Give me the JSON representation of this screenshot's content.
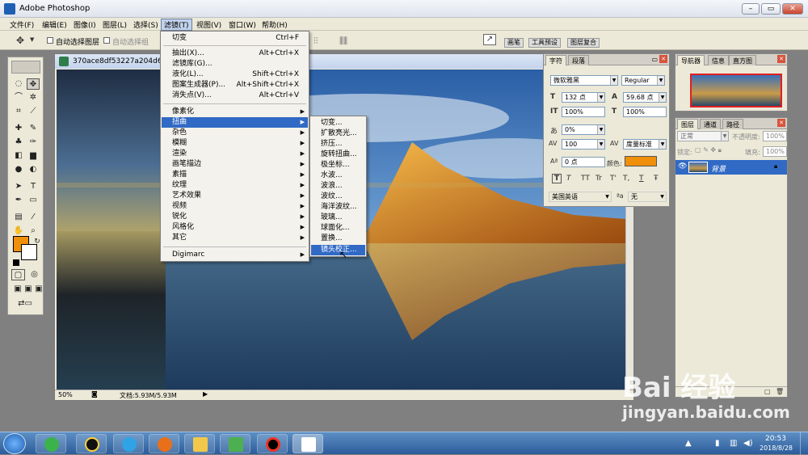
{
  "app": {
    "title": "Adobe Photoshop"
  },
  "menubar": [
    "文件(F)",
    "编辑(E)",
    "图像(I)",
    "图层(L)",
    "选择(S)",
    "滤镜(T)",
    "视图(V)",
    "窗口(W)",
    "帮助(H)"
  ],
  "options_bar": {
    "auto_select_layer": "自动选择图层",
    "auto_select_group": "自动选择组"
  },
  "palette_well": [
    "画笔",
    "工具预设",
    "图层复合"
  ],
  "document": {
    "title": "370ace8df53227a204d64c",
    "zoom": "50%",
    "doc_info": "文档:5.93M/5.93M"
  },
  "filter_menu": {
    "items": [
      {
        "label": "切变",
        "shortcut": "Ctrl+F"
      },
      {
        "label": "抽出(X)...",
        "shortcut": "Alt+Ctrl+X"
      },
      {
        "label": "滤镜库(G)...",
        "shortcut": ""
      },
      {
        "label": "液化(L)...",
        "shortcut": "Shift+Ctrl+X"
      },
      {
        "label": "图案生成器(P)...",
        "shortcut": "Alt+Shift+Ctrl+X"
      },
      {
        "label": "消失点(V)...",
        "shortcut": "Alt+Ctrl+V"
      },
      {
        "label": "像素化",
        "shortcut": ""
      },
      {
        "label": "扭曲",
        "shortcut": ""
      },
      {
        "label": "杂色",
        "shortcut": ""
      },
      {
        "label": "模糊",
        "shortcut": ""
      },
      {
        "label": "渲染",
        "shortcut": ""
      },
      {
        "label": "画笔描边",
        "shortcut": ""
      },
      {
        "label": "素描",
        "shortcut": ""
      },
      {
        "label": "纹理",
        "shortcut": ""
      },
      {
        "label": "艺术效果",
        "shortcut": ""
      },
      {
        "label": "视频",
        "shortcut": ""
      },
      {
        "label": "锐化",
        "shortcut": ""
      },
      {
        "label": "风格化",
        "shortcut": ""
      },
      {
        "label": "其它",
        "shortcut": ""
      },
      {
        "label": "Digimarc",
        "shortcut": ""
      }
    ]
  },
  "distort_submenu": [
    "切变...",
    "扩散亮光...",
    "挤压...",
    "旋转扭曲...",
    "极坐标...",
    "水波...",
    "波浪...",
    "波纹...",
    "海洋波纹...",
    "玻璃...",
    "球面化...",
    "置换...",
    "镜头校正..."
  ],
  "character_panel": {
    "tabs": [
      "字符",
      "段落"
    ],
    "font_family": "微软雅黑",
    "font_style": "Regular",
    "size": "132 点",
    "leading": "59.68 点",
    "vscale": "100%",
    "hscale": "100%",
    "tracking_kern": "0%",
    "tracking": "100",
    "kerning": "度量标准",
    "baseline": "0 点",
    "color_label": "颜色:",
    "color": "#f08f0a",
    "type_styles": [
      "T",
      "T",
      "TT",
      "Tr",
      "T'",
      "T,",
      "T",
      "Ŧ"
    ],
    "language": "美国英语",
    "aa_label": "a",
    "antialias": "无"
  },
  "navigator_panel": {
    "tabs": [
      "导航器",
      "信息",
      "直方图"
    ]
  },
  "layers_panel": {
    "tabs": [
      "图层",
      "通道",
      "路径"
    ],
    "blend_mode": "正常",
    "opacity_label": "不透明度:",
    "opacity": "100%",
    "lock_label": "锁定:",
    "fill_label": "填充:",
    "fill": "100%",
    "layer_name": "背景"
  },
  "taskbar": {
    "time": "20:53",
    "date": "2018/8/28"
  },
  "watermark": {
    "brand": "Bai 经验",
    "url": "jingyan.baidu.com"
  },
  "colors": {
    "foreground": "#f08f0a",
    "highlight": "#316ac5"
  }
}
